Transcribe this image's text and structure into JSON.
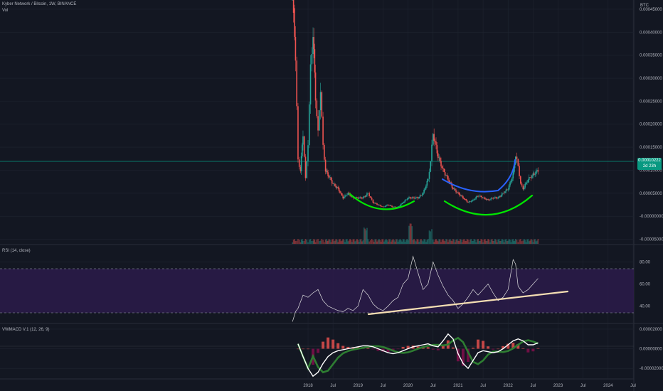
{
  "header": {
    "symbol_line": "Kyber Network / Bitcoin, 1W, BINANCE",
    "vol_label": "Vol",
    "currency": "BTC"
  },
  "price_tag": {
    "value": "0.00010222",
    "countdown": "2d 23h"
  },
  "panes": {
    "rsi": {
      "label": "RSI (14, close)"
    },
    "vwmacd": {
      "label": "VWMACD V.1 (12, 26, 9)"
    }
  },
  "colors": {
    "background": "#131722",
    "up": "#26a69a",
    "down": "#ef5350",
    "grid": "#1f2430",
    "rsi_line": "#e0e0e0",
    "rsi_band": "#2b1b4a",
    "drawing_green": "#00e600",
    "drawing_blue": "#2962ff",
    "trendline": "#f5deb3",
    "macd_line": "#ffffff",
    "signal_line": "#2e7d32",
    "hist_pos": "#ef5350",
    "hist_neg": "#880e4f"
  },
  "chart_data": [
    {
      "type": "candlestick",
      "title": "Kyber Network / Bitcoin, 1W, BINANCE",
      "y_axis_ticks": [
        "0.00045000",
        "0.00040000",
        "0.00035000",
        "0.00030000",
        "0.00025000",
        "0.00020000",
        "0.00015000",
        "0.00010000",
        "0.00005000",
        "-0.00000000",
        "-0.00005000"
      ],
      "ylim": [
        -6e-05,
        0.00047
      ],
      "x_axis_ticks": [
        "2018",
        "Jul",
        "2019",
        "Jul",
        "2020",
        "Jul",
        "2021",
        "Jul",
        "2022",
        "Jul",
        "2023",
        "Jul",
        "2024",
        "Jul"
      ],
      "last_price": 0.00010222,
      "series": [
        {
          "name": "price",
          "x": [
            2017.69,
            2017.75,
            2017.8,
            2017.85,
            2017.9,
            2017.95,
            2018.0,
            2018.05,
            2018.1,
            2018.15,
            2018.2,
            2018.25,
            2018.3,
            2018.35,
            2018.4,
            2018.5,
            2018.6,
            2018.7,
            2018.8,
            2018.9,
            2019.0,
            2019.1,
            2019.2,
            2019.25,
            2019.3,
            2019.4,
            2019.5,
            2019.6,
            2019.7,
            2019.8,
            2019.9,
            2020.0,
            2020.1,
            2020.2,
            2020.3,
            2020.4,
            2020.45,
            2020.5,
            2020.6,
            2020.7,
            2020.8,
            2020.9,
            2021.0,
            2021.1,
            2021.2,
            2021.3,
            2021.4,
            2021.5,
            2021.6,
            2021.7,
            2021.8,
            2021.9,
            2022.0,
            2022.1,
            2022.15,
            2022.2,
            2022.25,
            2022.3,
            2022.4,
            2022.5,
            2022.6
          ],
          "y": [
            0.00048,
            0.00035,
            0.00012,
            0.0001,
            0.00018,
            8e-05,
            0.00016,
            0.00032,
            0.0004,
            0.00026,
            0.00018,
            0.00028,
            0.00015,
            0.0001,
            9e-05,
            7e-05,
            6e-05,
            4e-05,
            5e-05,
            4e-05,
            4e-05,
            4e-05,
            5e-05,
            4e-05,
            3e-05,
            2.5e-05,
            2e-05,
            2.5e-05,
            2e-05,
            2e-05,
            3e-05,
            4e-05,
            4e-05,
            4e-05,
            5e-05,
            8e-05,
            0.00012,
            0.00018,
            0.00013,
            0.0001,
            8e-05,
            6e-05,
            5e-05,
            4e-05,
            3e-05,
            3.5e-05,
            4.5e-05,
            4e-05,
            3.5e-05,
            4e-05,
            4e-05,
            5e-05,
            6e-05,
            9e-05,
            0.00013,
            0.00011,
            7e-05,
            6e-05,
            8e-05,
            9e-05,
            0.0001
          ]
        }
      ]
    },
    {
      "type": "line",
      "title": "RSI (14, close)",
      "y_axis_ticks": [
        "80.00",
        "60.00",
        "40.00"
      ],
      "ylim": [
        25,
        95
      ],
      "band": [
        30,
        70
      ],
      "series": [
        {
          "name": "RSI",
          "x": [
            2017.69,
            2017.75,
            2017.8,
            2017.9,
            2018.0,
            2018.1,
            2018.2,
            2018.3,
            2018.4,
            2018.5,
            2018.6,
            2018.7,
            2018.8,
            2018.9,
            2019.0,
            2019.1,
            2019.2,
            2019.3,
            2019.4,
            2019.5,
            2019.6,
            2019.7,
            2019.8,
            2019.9,
            2020.0,
            2020.1,
            2020.2,
            2020.3,
            2020.4,
            2020.5,
            2020.6,
            2020.7,
            2020.8,
            2020.9,
            2021.0,
            2021.1,
            2021.2,
            2021.3,
            2021.4,
            2021.5,
            2021.6,
            2021.7,
            2021.8,
            2021.9,
            2022.0,
            2022.1,
            2022.15,
            2022.2,
            2022.3,
            2022.4,
            2022.5,
            2022.6
          ],
          "y": [
            26,
            35,
            38,
            50,
            48,
            52,
            55,
            45,
            40,
            38,
            36,
            35,
            38,
            36,
            40,
            55,
            50,
            42,
            38,
            36,
            40,
            45,
            48,
            60,
            65,
            85,
            70,
            55,
            60,
            80,
            68,
            58,
            50,
            45,
            38,
            42,
            48,
            55,
            50,
            55,
            60,
            52,
            45,
            48,
            55,
            82,
            78,
            58,
            52,
            55,
            60,
            65
          ]
        }
      ]
    },
    {
      "type": "line",
      "title": "VWMACD V.1 (12, 26, 9)",
      "y_axis_ticks": [
        "0.00002000",
        "0.00000000",
        "-0.00002000"
      ],
      "ylim": [
        -3e-05,
        2.5e-05
      ],
      "series": [
        {
          "name": "VWMACD",
          "x": [
            2017.8,
            2017.9,
            2018.0,
            2018.1,
            2018.2,
            2018.3,
            2018.4,
            2018.5,
            2018.6,
            2018.7,
            2018.8,
            2018.9,
            2019.0,
            2019.1,
            2019.2,
            2019.3,
            2019.4,
            2019.5,
            2019.6,
            2019.7,
            2019.8,
            2019.9,
            2020.0,
            2020.1,
            2020.2,
            2020.3,
            2020.4,
            2020.5,
            2020.6,
            2020.7,
            2020.8,
            2020.9,
            2021.0,
            2021.1,
            2021.2,
            2021.3,
            2021.4,
            2021.5,
            2021.6,
            2021.7,
            2021.8,
            2021.9,
            2022.0,
            2022.1,
            2022.2,
            2022.3,
            2022.4,
            2022.5,
            2022.6
          ],
          "y": [
            5e-06,
            -8e-06,
            -2e-05,
            -2.8e-05,
            -2.4e-05,
            -1.5e-05,
            -8e-06,
            -4e-06,
            -2e-06,
            -1e-06,
            0.0,
            1e-06,
            2e-06,
            3e-06,
            3e-06,
            2e-06,
            0.0,
            -2e-06,
            -4e-06,
            -5e-06,
            -4e-06,
            -2e-06,
            0.0,
            2e-06,
            3e-06,
            4e-06,
            5e-06,
            3e-06,
            2e-06,
            8e-06,
            1.5e-05,
            1e-05,
            -5e-06,
            -1.5e-05,
            -2e-05,
            -1.2e-05,
            -4e-06,
            -2e-06,
            -3e-06,
            -4e-06,
            -3e-06,
            0.0,
            4e-06,
            8e-06,
            1e-05,
            8e-06,
            4e-06,
            4e-06,
            6e-06
          ]
        }
      ]
    }
  ]
}
